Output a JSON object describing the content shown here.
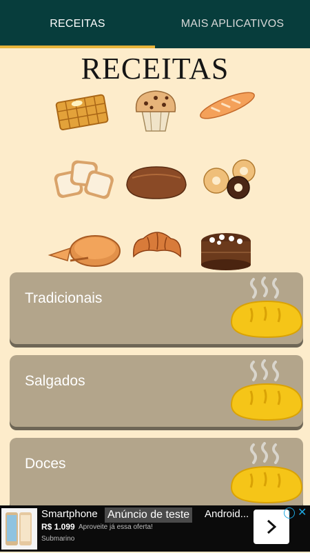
{
  "tabs": [
    {
      "label": "RECEITAS",
      "active": true
    },
    {
      "label": "MAIS APLICATIVOS",
      "active": false
    }
  ],
  "title": "RECEITAS",
  "illustrations": [
    "waffle-icon",
    "muffin-icon",
    "baguette-icon",
    "bread-slices-icon",
    "round-loaf-icon",
    "donuts-icon",
    "pie-icon",
    "croissant-icon",
    "chocolate-cake-icon"
  ],
  "categories": [
    {
      "label": "Tradicionais",
      "icon": "bread-loaf-icon"
    },
    {
      "label": "Salgados",
      "icon": "bread-loaf-icon"
    },
    {
      "label": "Doces",
      "icon": "bread-loaf-icon"
    }
  ],
  "ad": {
    "title_left": "Smartphone",
    "test_label": "Anúncio de teste",
    "title_right": "Android...",
    "price": "R$ 1.099",
    "subtitle": "Aproveite já essa oferta!",
    "advertiser": "Submarino",
    "cta_icon": "chevron-right-icon"
  },
  "colors": {
    "tabbar": "#073d3c",
    "tab_indicator": "#e8b43a",
    "background": "#fdeccb",
    "card": "#b3a58b",
    "bread": "#f5c518"
  }
}
